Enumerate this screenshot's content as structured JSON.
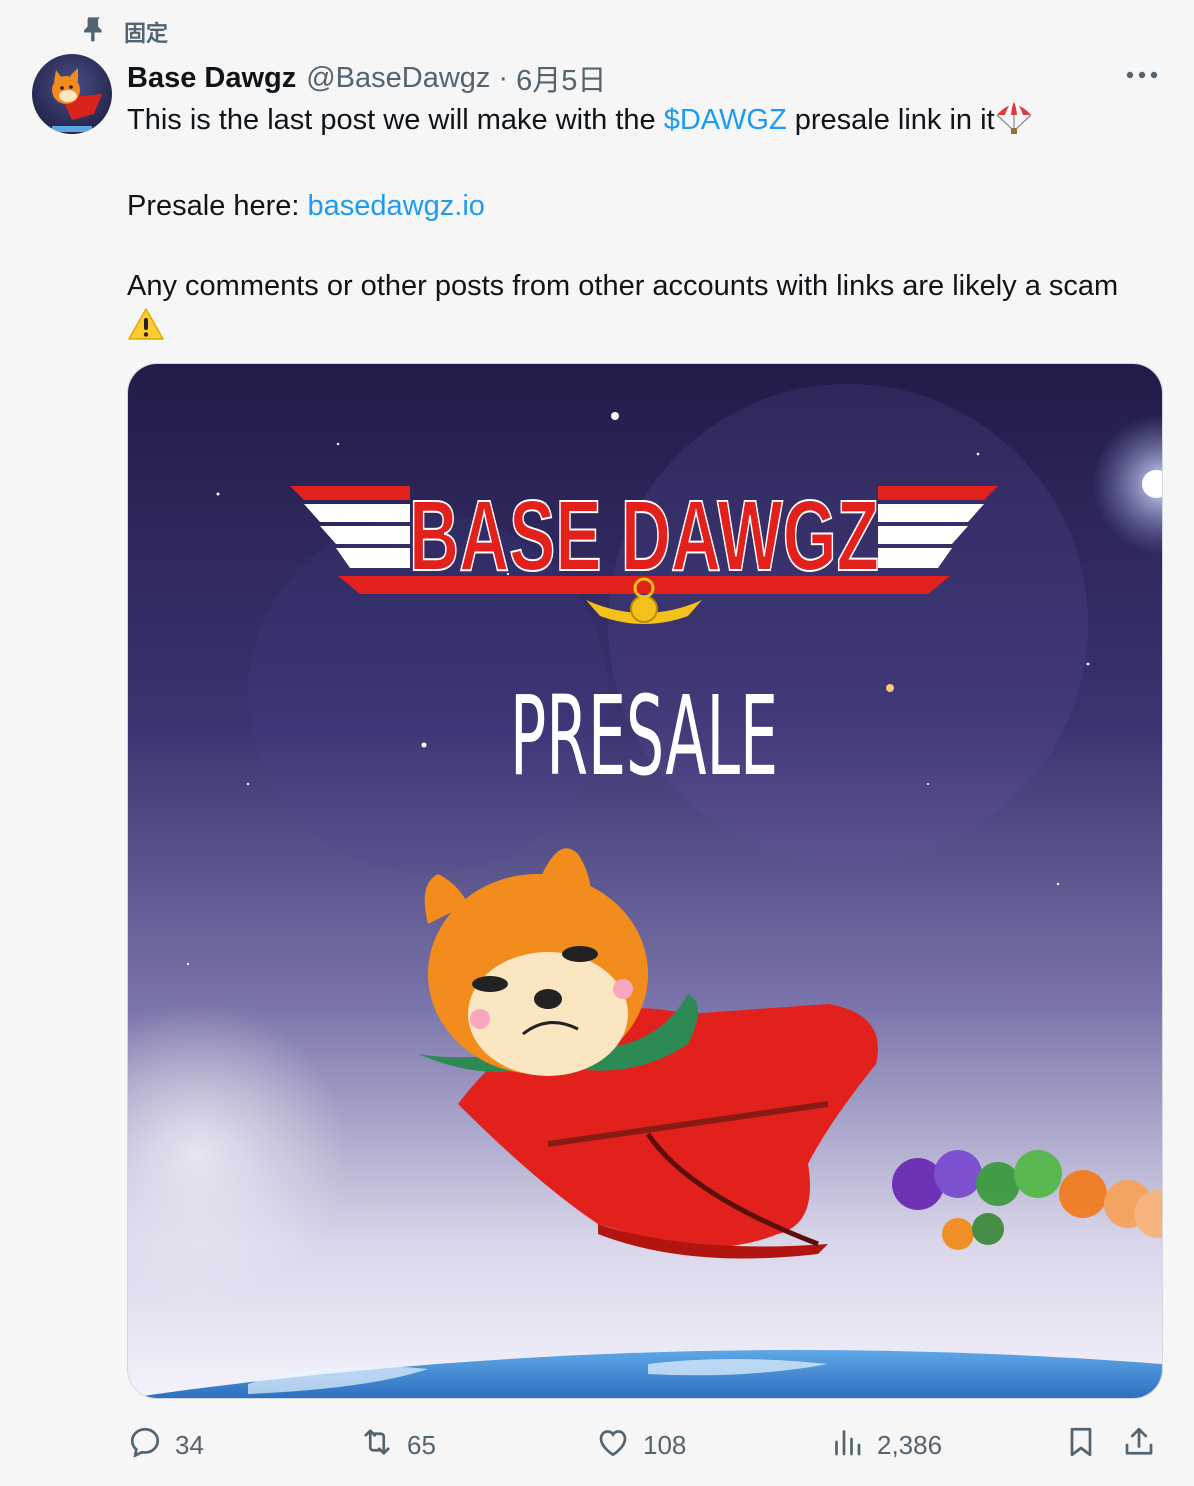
{
  "pinned": {
    "label": "固定",
    "icon": "pin-icon"
  },
  "author": {
    "display_name": "Base Dawgz",
    "handle": "@BaseDawgz",
    "separator": "·",
    "date": "6月5日"
  },
  "post": {
    "line1_before": "This is the last post we will make with the ",
    "line1_cashtag": "$DAWGZ",
    "line1_after": " presale link in it",
    "line1_emoji": "parachute-emoji",
    "line2_label": "Presale here: ",
    "line2_link": "basedawgz.io",
    "line3": "Any comments or other posts from other accounts with links are likely a scam",
    "line3_emoji": "warning-emoji"
  },
  "media": {
    "title": "BASE DAWGZ",
    "subtitle": "PRESALE",
    "colors": {
      "red": "#e2211c",
      "sky_top": "#221c4a",
      "sky_bottom": "#f4f2fb"
    }
  },
  "actions": {
    "replies": "34",
    "reposts": "65",
    "likes": "108",
    "views": "2,386"
  },
  "colors": {
    "link": "#1d9bf0",
    "muted": "#536471",
    "text": "#0f1419"
  }
}
